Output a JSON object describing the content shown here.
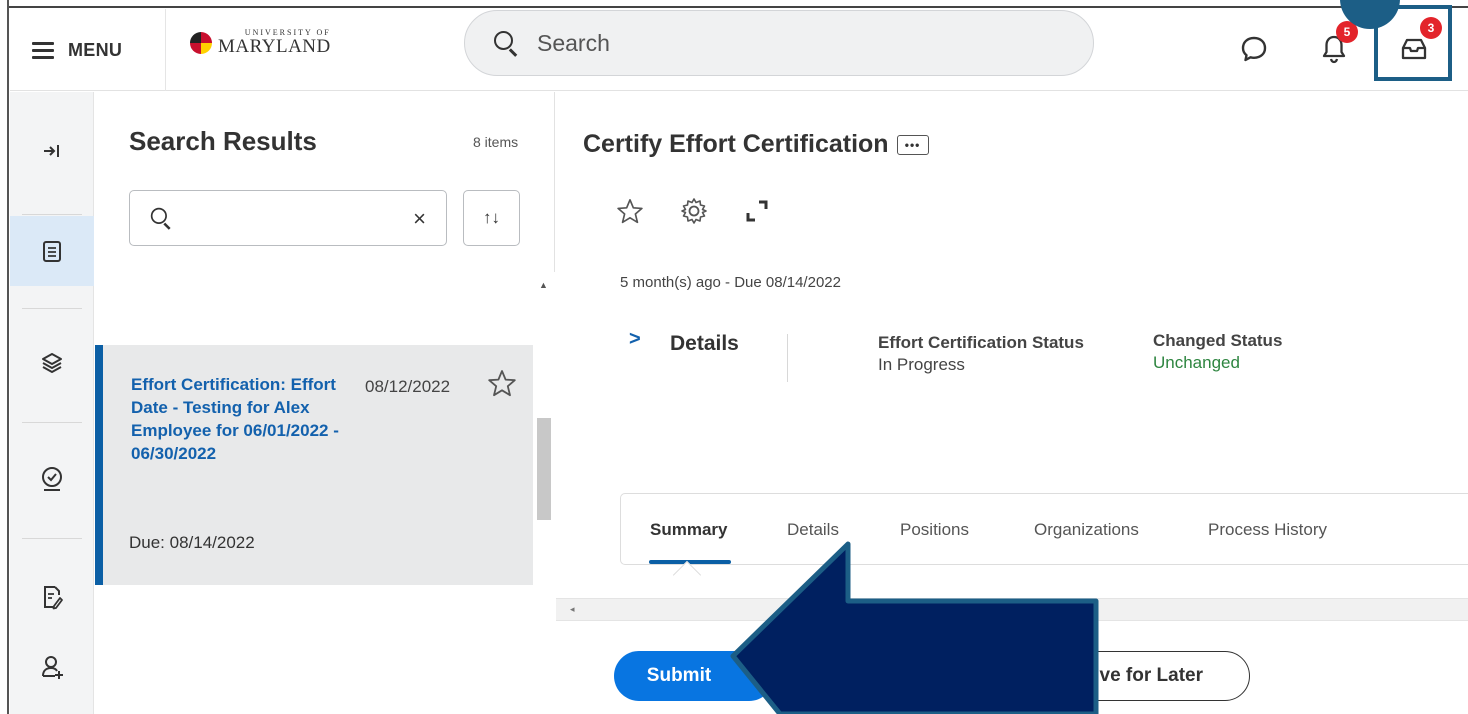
{
  "topbar": {
    "menu_label": "MENU",
    "logo_small": "UNIVERSITY OF",
    "logo_big": "MARYLAND",
    "search_placeholder": "Search",
    "notifications_badge": "5",
    "inbox_badge": "3"
  },
  "results": {
    "title": "Search Results",
    "count": "8 items",
    "clear_glyph": "×",
    "sort_glyph": "↑↓",
    "card": {
      "title": "Effort Certification: Effort Date - Testing for Alex Employee for 06/01/2022 - 06/30/2022",
      "date": "08/12/2022",
      "due": "Due: 08/14/2022"
    }
  },
  "main": {
    "title": "Certify Effort Certification",
    "more_glyph": "•••",
    "due_line": "5 month(s) ago - Due 08/14/2022",
    "details_chevron": ">",
    "details_label": "Details",
    "fields": [
      {
        "label": "Effort Certification Status",
        "value": "In Progress"
      },
      {
        "label": "Changed Status",
        "value": "Unchanged"
      }
    ],
    "tabs": [
      "Summary",
      "Details",
      "Positions",
      "Organizations",
      "Process History"
    ],
    "submit_label": "Submit",
    "save_label": "Save for Later",
    "save_visible": "ve for Later"
  },
  "colors": {
    "accent_blue": "#0875e1",
    "link_blue": "#1361ad",
    "status_green": "#2e8540",
    "badge_red": "#e3242b",
    "callout_navy": "#002060",
    "callout_border": "#1c5e86"
  }
}
